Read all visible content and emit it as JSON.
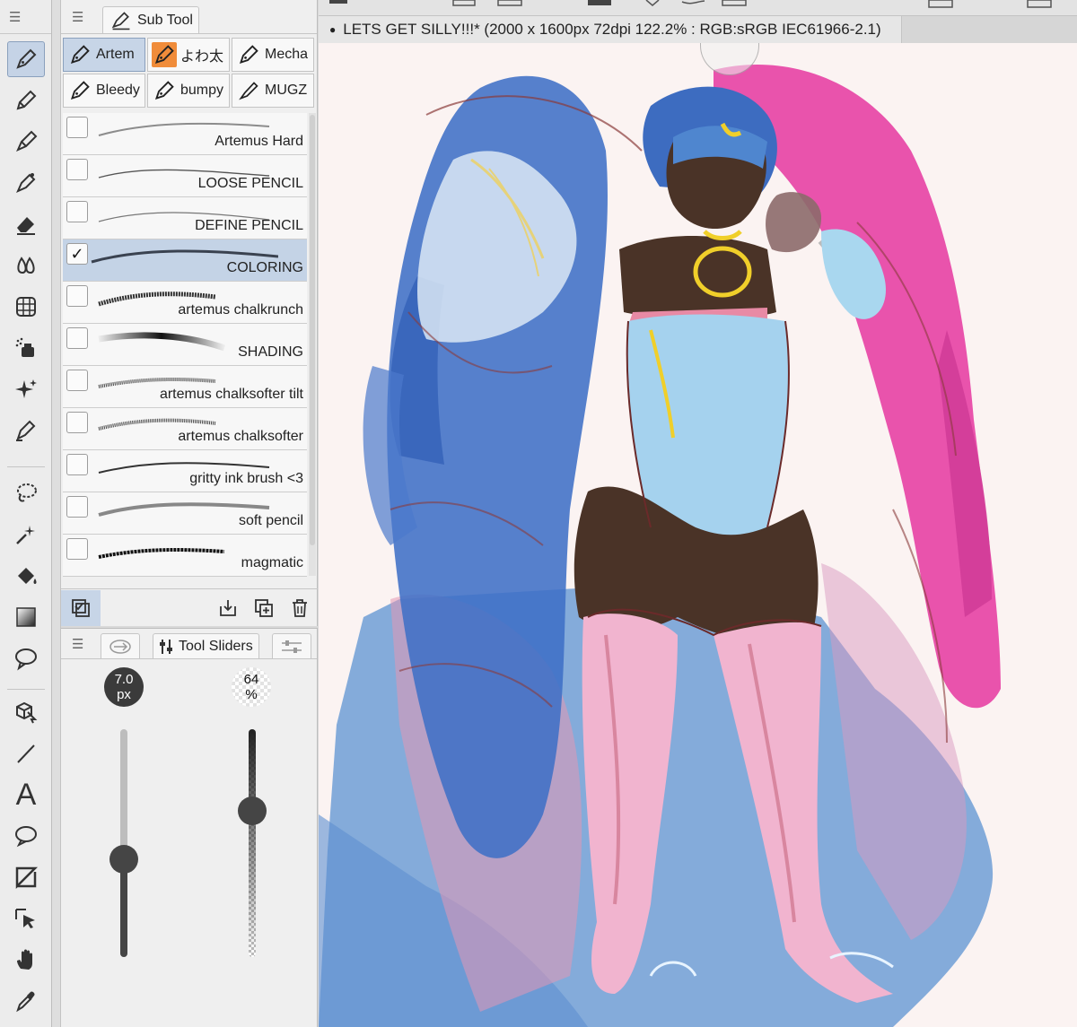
{
  "sub_tool_panel": {
    "tab_label": "Sub Tool",
    "groups": [
      "Artem",
      "よわ太",
      "Mecha",
      "Bleedy",
      "bumpy",
      "MUGZ"
    ],
    "brushes": [
      {
        "name": "Artemus Hard",
        "checked": false
      },
      {
        "name": "LOOSE PENCIL",
        "checked": false
      },
      {
        "name": "DEFINE PENCIL",
        "checked": false
      },
      {
        "name": "COLORING",
        "checked": true
      },
      {
        "name": "artemus chalkrunch",
        "checked": false
      },
      {
        "name": "SHADING",
        "checked": false
      },
      {
        "name": "artemus chalksofter tilt",
        "checked": false
      },
      {
        "name": "artemus chalksofter",
        "checked": false
      },
      {
        "name": "gritty ink brush <3",
        "checked": false
      },
      {
        "name": "soft pencil",
        "checked": false
      },
      {
        "name": "magmatic",
        "checked": false
      }
    ],
    "check_glyph": "✓"
  },
  "tool_sliders": {
    "tab_label": "Tool Sliders",
    "size": {
      "value": "7.0",
      "unit": "px",
      "fraction": 0.43
    },
    "opacity": {
      "value": "64",
      "unit": "%",
      "fraction": 0.64
    }
  },
  "document": {
    "title": "LETS GET SILLY!!!* (2000 x 1600px 72dpi 122.2% : RGB:sRGB IEC61966-2.1)",
    "bullet": "●"
  },
  "tools": [
    "pen-icon",
    "pencil-icon",
    "brush-icon",
    "airbrush-icon",
    "eraser-icon",
    "blend-icon",
    "decoration-icon",
    "spray-icon",
    "sparkle-icon",
    "correct-line-icon",
    "lasso-icon",
    "auto-select-icon",
    "fill-icon",
    "gradient-icon",
    "balloon-icon",
    "operation-icon",
    "line-icon",
    "text-icon",
    "speech-bubble-icon",
    "frame-icon",
    "object-select-icon",
    "hand-icon",
    "eyedropper-icon"
  ],
  "text_tool_glyph": "A",
  "colors": {
    "selection": "#c5d3e6",
    "orange_group": "#f08c3a",
    "canvas_bg": "#fbf3f2"
  }
}
